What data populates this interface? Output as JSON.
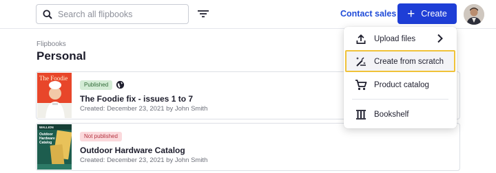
{
  "search": {
    "placeholder": "Search all flipbooks"
  },
  "header": {
    "contact_label": "Contact sales",
    "create_label": "Create"
  },
  "breadcrumb": "Flipbooks",
  "page_title": "Personal",
  "flipbooks": [
    {
      "status": "Published",
      "title": "The Foodie fix - issues 1 to 7",
      "meta": "Created: December 23, 2021 by John Smith",
      "cover_text": "The Foodie"
    },
    {
      "status": "Not published",
      "title": "Outdoor Hardware Catalog",
      "meta": "Created: December 23, 2021 by John Smith",
      "cover_text": "Outdoor Hardware Catalog"
    }
  ],
  "create_menu": {
    "items": [
      {
        "label": "Upload files",
        "icon": "upload-icon"
      },
      {
        "label": "Create from scratch",
        "icon": "magic-wand-icon"
      },
      {
        "label": "Product catalog",
        "icon": "shopping-cart-icon"
      },
      {
        "label": "Bookshelf",
        "icon": "bookshelf-icon"
      }
    ]
  },
  "colors": {
    "accent": "#1e3ed6",
    "link": "#1f4bd8",
    "highlight_border": "#f0c238",
    "published_bg": "#d4ecd6",
    "unpublished_bg": "#fbd9dc"
  }
}
